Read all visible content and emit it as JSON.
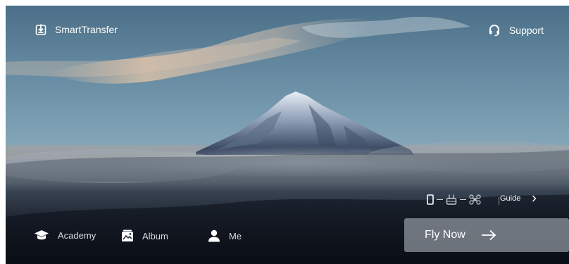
{
  "header": {
    "app_name": "SmartTransfer",
    "support_label": "Support"
  },
  "connection": {
    "guide_label": "Guide"
  },
  "bottom_nav": {
    "items": [
      {
        "label": "Academy",
        "icon": "graduation-cap-icon"
      },
      {
        "label": "Album",
        "icon": "album-icon"
      },
      {
        "label": "Me",
        "icon": "person-icon"
      }
    ]
  },
  "primary_action": {
    "label": "Fly Now",
    "icon": "arrow-right-icon"
  },
  "colors": {
    "sky_top": "#4f7590",
    "sky_mid": "#7d9fb3",
    "cloud_warm": "#e7c3a3",
    "mountain": "#2b3a52",
    "snow": "#dfe6ef",
    "ground": "#0f1420",
    "button_bg": "#aab0b8"
  }
}
